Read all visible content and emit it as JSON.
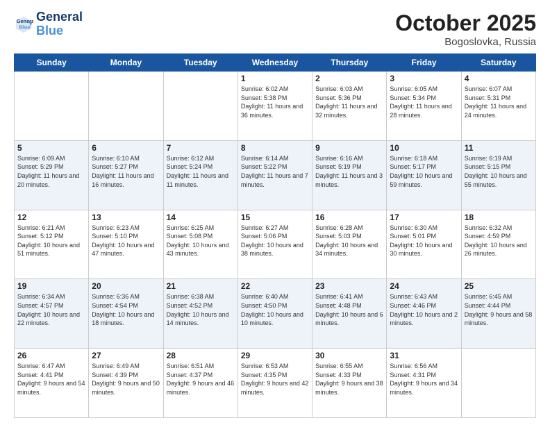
{
  "header": {
    "logo_line1": "General",
    "logo_line2": "Blue",
    "month": "October 2025",
    "location": "Bogoslovka, Russia"
  },
  "days_of_week": [
    "Sunday",
    "Monday",
    "Tuesday",
    "Wednesday",
    "Thursday",
    "Friday",
    "Saturday"
  ],
  "weeks": [
    [
      {
        "day": "",
        "sunrise": "",
        "sunset": "",
        "daylight": ""
      },
      {
        "day": "",
        "sunrise": "",
        "sunset": "",
        "daylight": ""
      },
      {
        "day": "",
        "sunrise": "",
        "sunset": "",
        "daylight": ""
      },
      {
        "day": "1",
        "sunrise": "Sunrise: 6:02 AM",
        "sunset": "Sunset: 5:38 PM",
        "daylight": "Daylight: 11 hours and 36 minutes."
      },
      {
        "day": "2",
        "sunrise": "Sunrise: 6:03 AM",
        "sunset": "Sunset: 5:36 PM",
        "daylight": "Daylight: 11 hours and 32 minutes."
      },
      {
        "day": "3",
        "sunrise": "Sunrise: 6:05 AM",
        "sunset": "Sunset: 5:34 PM",
        "daylight": "Daylight: 11 hours and 28 minutes."
      },
      {
        "day": "4",
        "sunrise": "Sunrise: 6:07 AM",
        "sunset": "Sunset: 5:31 PM",
        "daylight": "Daylight: 11 hours and 24 minutes."
      }
    ],
    [
      {
        "day": "5",
        "sunrise": "Sunrise: 6:09 AM",
        "sunset": "Sunset: 5:29 PM",
        "daylight": "Daylight: 11 hours and 20 minutes."
      },
      {
        "day": "6",
        "sunrise": "Sunrise: 6:10 AM",
        "sunset": "Sunset: 5:27 PM",
        "daylight": "Daylight: 11 hours and 16 minutes."
      },
      {
        "day": "7",
        "sunrise": "Sunrise: 6:12 AM",
        "sunset": "Sunset: 5:24 PM",
        "daylight": "Daylight: 11 hours and 11 minutes."
      },
      {
        "day": "8",
        "sunrise": "Sunrise: 6:14 AM",
        "sunset": "Sunset: 5:22 PM",
        "daylight": "Daylight: 11 hours and 7 minutes."
      },
      {
        "day": "9",
        "sunrise": "Sunrise: 6:16 AM",
        "sunset": "Sunset: 5:19 PM",
        "daylight": "Daylight: 11 hours and 3 minutes."
      },
      {
        "day": "10",
        "sunrise": "Sunrise: 6:18 AM",
        "sunset": "Sunset: 5:17 PM",
        "daylight": "Daylight: 10 hours and 59 minutes."
      },
      {
        "day": "11",
        "sunrise": "Sunrise: 6:19 AM",
        "sunset": "Sunset: 5:15 PM",
        "daylight": "Daylight: 10 hours and 55 minutes."
      }
    ],
    [
      {
        "day": "12",
        "sunrise": "Sunrise: 6:21 AM",
        "sunset": "Sunset: 5:12 PM",
        "daylight": "Daylight: 10 hours and 51 minutes."
      },
      {
        "day": "13",
        "sunrise": "Sunrise: 6:23 AM",
        "sunset": "Sunset: 5:10 PM",
        "daylight": "Daylight: 10 hours and 47 minutes."
      },
      {
        "day": "14",
        "sunrise": "Sunrise: 6:25 AM",
        "sunset": "Sunset: 5:08 PM",
        "daylight": "Daylight: 10 hours and 43 minutes."
      },
      {
        "day": "15",
        "sunrise": "Sunrise: 6:27 AM",
        "sunset": "Sunset: 5:06 PM",
        "daylight": "Daylight: 10 hours and 38 minutes."
      },
      {
        "day": "16",
        "sunrise": "Sunrise: 6:28 AM",
        "sunset": "Sunset: 5:03 PM",
        "daylight": "Daylight: 10 hours and 34 minutes."
      },
      {
        "day": "17",
        "sunrise": "Sunrise: 6:30 AM",
        "sunset": "Sunset: 5:01 PM",
        "daylight": "Daylight: 10 hours and 30 minutes."
      },
      {
        "day": "18",
        "sunrise": "Sunrise: 6:32 AM",
        "sunset": "Sunset: 4:59 PM",
        "daylight": "Daylight: 10 hours and 26 minutes."
      }
    ],
    [
      {
        "day": "19",
        "sunrise": "Sunrise: 6:34 AM",
        "sunset": "Sunset: 4:57 PM",
        "daylight": "Daylight: 10 hours and 22 minutes."
      },
      {
        "day": "20",
        "sunrise": "Sunrise: 6:36 AM",
        "sunset": "Sunset: 4:54 PM",
        "daylight": "Daylight: 10 hours and 18 minutes."
      },
      {
        "day": "21",
        "sunrise": "Sunrise: 6:38 AM",
        "sunset": "Sunset: 4:52 PM",
        "daylight": "Daylight: 10 hours and 14 minutes."
      },
      {
        "day": "22",
        "sunrise": "Sunrise: 6:40 AM",
        "sunset": "Sunset: 4:50 PM",
        "daylight": "Daylight: 10 hours and 10 minutes."
      },
      {
        "day": "23",
        "sunrise": "Sunrise: 6:41 AM",
        "sunset": "Sunset: 4:48 PM",
        "daylight": "Daylight: 10 hours and 6 minutes."
      },
      {
        "day": "24",
        "sunrise": "Sunrise: 6:43 AM",
        "sunset": "Sunset: 4:46 PM",
        "daylight": "Daylight: 10 hours and 2 minutes."
      },
      {
        "day": "25",
        "sunrise": "Sunrise: 6:45 AM",
        "sunset": "Sunset: 4:44 PM",
        "daylight": "Daylight: 9 hours and 58 minutes."
      }
    ],
    [
      {
        "day": "26",
        "sunrise": "Sunrise: 6:47 AM",
        "sunset": "Sunset: 4:41 PM",
        "daylight": "Daylight: 9 hours and 54 minutes."
      },
      {
        "day": "27",
        "sunrise": "Sunrise: 6:49 AM",
        "sunset": "Sunset: 4:39 PM",
        "daylight": "Daylight: 9 hours and 50 minutes."
      },
      {
        "day": "28",
        "sunrise": "Sunrise: 6:51 AM",
        "sunset": "Sunset: 4:37 PM",
        "daylight": "Daylight: 9 hours and 46 minutes."
      },
      {
        "day": "29",
        "sunrise": "Sunrise: 6:53 AM",
        "sunset": "Sunset: 4:35 PM",
        "daylight": "Daylight: 9 hours and 42 minutes."
      },
      {
        "day": "30",
        "sunrise": "Sunrise: 6:55 AM",
        "sunset": "Sunset: 4:33 PM",
        "daylight": "Daylight: 9 hours and 38 minutes."
      },
      {
        "day": "31",
        "sunrise": "Sunrise: 6:56 AM",
        "sunset": "Sunset: 4:31 PM",
        "daylight": "Daylight: 9 hours and 34 minutes."
      },
      {
        "day": "",
        "sunrise": "",
        "sunset": "",
        "daylight": ""
      }
    ]
  ]
}
